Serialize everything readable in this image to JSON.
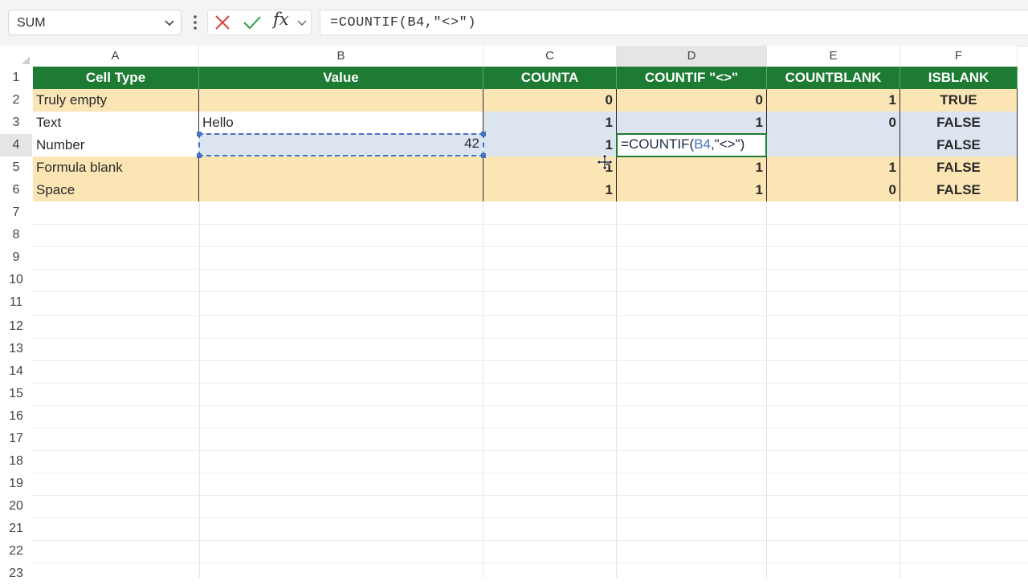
{
  "formula_bar": {
    "name_box": "SUM",
    "formula": "=COUNTIF(B4,\"<>\")",
    "fx": "fx"
  },
  "columns": [
    "A",
    "B",
    "C",
    "D",
    "E",
    "F"
  ],
  "rows": [
    "1",
    "2",
    "3",
    "4",
    "5",
    "6",
    "7",
    "8",
    "9",
    "10",
    "11",
    "12",
    "13",
    "14",
    "15",
    "16",
    "17",
    "18",
    "19",
    "20",
    "21",
    "22",
    "23"
  ],
  "table": {
    "headers": [
      "Cell Type",
      "Value",
      "COUNTA",
      "COUNTIF \"<>\"",
      "COUNTBLANK",
      "ISBLANK"
    ],
    "rows": [
      {
        "type": "Truly empty",
        "value": "",
        "counta": "0",
        "countif": "0",
        "countblank": "1",
        "isblank": "TRUE"
      },
      {
        "type": "Text",
        "value": "Hello",
        "counta": "1",
        "countif": "1",
        "countblank": "0",
        "isblank": "FALSE"
      },
      {
        "type": "Number",
        "value": "42",
        "counta": "1",
        "countif": "",
        "countblank": "",
        "isblank": "FALSE"
      },
      {
        "type": "Formula blank",
        "value": "",
        "counta": "1",
        "countif": "1",
        "countblank": "1",
        "isblank": "FALSE"
      },
      {
        "type": "Space",
        "value": "",
        "counta": "1",
        "countif": "1",
        "countblank": "0",
        "isblank": "FALSE"
      }
    ]
  },
  "editing": {
    "prefix": "=COUNTIF(",
    "ref": "B4",
    "suffix": ",\"<>\")"
  },
  "colors": {
    "header_green": "#1e7b34",
    "peach": "#fbe5b4",
    "blue": "#dbe4ef",
    "ref_blue": "#4472c4"
  }
}
